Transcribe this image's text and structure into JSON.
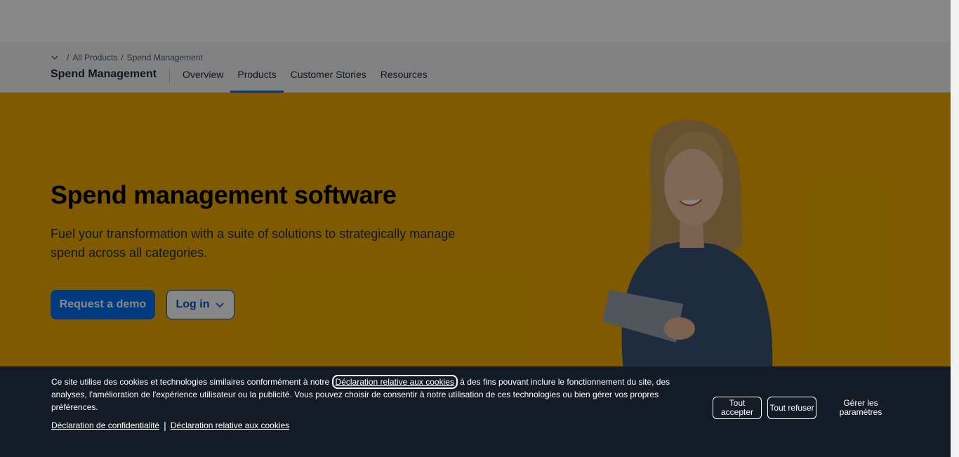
{
  "colors": {
    "hero_bg": "#f0ab00",
    "primary_button": "#0070f2",
    "cookie_bg": "#131c26",
    "nav_active_underline": "#0070f2"
  },
  "breadcrumb": {
    "toggle_icon": "chevron-down-icon",
    "items": [
      "All Products",
      "Spend Management"
    ]
  },
  "subnav": {
    "title": "Spend Management",
    "tabs": [
      {
        "label": "Overview",
        "active": false
      },
      {
        "label": "Products",
        "active": true
      },
      {
        "label": "Customer Stories",
        "active": false
      },
      {
        "label": "Resources",
        "active": false
      }
    ]
  },
  "hero": {
    "title": "Spend management software",
    "subtitle": "Fuel your transformation with a suite of solutions to strategically manage spend across all categories.",
    "demo_button": "Request a demo",
    "login_button": "Log in",
    "login_icon": "chevron-down-icon"
  },
  "cookie": {
    "text_before": "Ce site utilise des cookies et technologies similaires conformément à notre ",
    "inline_link": "Déclaration relative aux cookies",
    "text_after": " à des fins pouvant inclure le fonctionnement du site, des analyses, l'amélioration de l'expérience utilisateur ou la publicité. Vous pouvez choisir de consentir à notre utilisation de ces technologies ou bien gérer vos propres préférences.",
    "privacy_link": "Déclaration de confidentialité",
    "separator": "|",
    "cookies_link": "Déclaration relative aux cookies",
    "accept_button": "Tout accepter",
    "refuse_button": "Tout refuser",
    "manage_button": "Gérer les paramètres"
  }
}
